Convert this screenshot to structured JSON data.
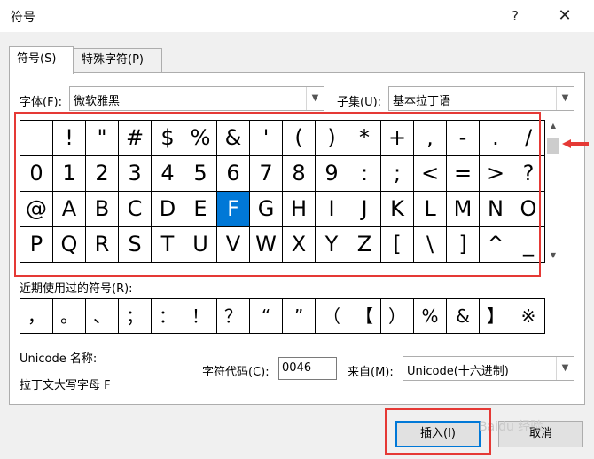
{
  "window": {
    "title": "符号",
    "help": "?",
    "close": "✕"
  },
  "tabs": {
    "symbols": "符号(S)",
    "special": "特殊字符(P)"
  },
  "font": {
    "label": "字体(F):",
    "value": "微软雅黑"
  },
  "subset": {
    "label": "子集(U):",
    "value": "基本拉丁语"
  },
  "grid": {
    "rows": [
      [
        "",
        "!",
        "\"",
        "#",
        "$",
        "%",
        "&",
        "'",
        "(",
        ")",
        "*",
        "+",
        ",",
        "-",
        ".",
        "/"
      ],
      [
        "0",
        "1",
        "2",
        "3",
        "4",
        "5",
        "6",
        "7",
        "8",
        "9",
        ":",
        ";",
        "<",
        "=",
        ">",
        "?"
      ],
      [
        "@",
        "A",
        "B",
        "C",
        "D",
        "E",
        "F",
        "G",
        "H",
        "I",
        "J",
        "K",
        "L",
        "M",
        "N",
        "O"
      ],
      [
        "P",
        "Q",
        "R",
        "S",
        "T",
        "U",
        "V",
        "W",
        "X",
        "Y",
        "Z",
        "[",
        "\\",
        "]",
        "^",
        "_"
      ]
    ],
    "selected": "F"
  },
  "recent": {
    "label": "近期使用过的符号(R):",
    "items": [
      "，",
      "。",
      "、",
      "；",
      "：",
      "！",
      "？",
      "“",
      "”",
      "（",
      "【",
      "）",
      "%",
      "&",
      "】",
      "※"
    ]
  },
  "unicode_name": {
    "label": "Unicode 名称:",
    "value": "拉丁文大写字母 F"
  },
  "char_code": {
    "label": "字符代码(C):",
    "value": "0046"
  },
  "from": {
    "label": "来自(M):",
    "value": "Unicode(十六进制)"
  },
  "buttons": {
    "insert": "插入(I)",
    "cancel": "取消"
  },
  "watermark": "Baidu 经验",
  "colors": {
    "selection": "#0078d7",
    "annotation": "#e53935"
  }
}
